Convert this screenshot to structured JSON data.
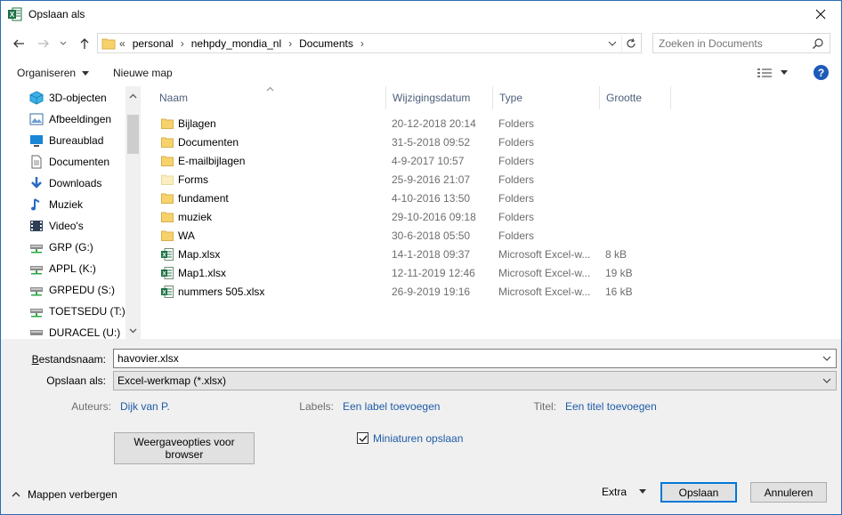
{
  "window": {
    "title": "Opslaan als",
    "close_label": "✕"
  },
  "address": {
    "overflow": "«",
    "crumbs": [
      "personal",
      "nehpdy_mondia_nl",
      "Documents"
    ]
  },
  "search": {
    "placeholder": "Zoeken in Documents"
  },
  "toolbar": {
    "organize_label": "Organiseren",
    "new_folder_label": "Nieuwe map",
    "help_label": "?"
  },
  "nav": {
    "items": [
      {
        "label": "3D-objecten",
        "icon": "3d-objects-icon"
      },
      {
        "label": "Afbeeldingen",
        "icon": "pictures-icon"
      },
      {
        "label": "Bureaublad",
        "icon": "desktop-icon"
      },
      {
        "label": "Documenten",
        "icon": "documents-icon"
      },
      {
        "label": "Downloads",
        "icon": "downloads-icon"
      },
      {
        "label": "Muziek",
        "icon": "music-icon"
      },
      {
        "label": "Video's",
        "icon": "videos-icon"
      },
      {
        "label": "GRP (G:)",
        "icon": "network-drive-icon"
      },
      {
        "label": "APPL (K:)",
        "icon": "network-drive-icon"
      },
      {
        "label": "GRPEDU (S:)",
        "icon": "network-drive-icon"
      },
      {
        "label": "TOETSEDU (T:)",
        "icon": "network-drive-icon"
      },
      {
        "label": "DURACEL (U:)",
        "icon": "usb-drive-icon"
      }
    ]
  },
  "columns": {
    "name": "Naam",
    "date": "Wijzigingsdatum",
    "type": "Type",
    "size": "Grootte"
  },
  "files": [
    {
      "name": "Bijlagen",
      "date": "20-12-2018 20:14",
      "type": "Folders",
      "size": "",
      "kind": "folder"
    },
    {
      "name": "Documenten",
      "date": "31-5-2018 09:52",
      "type": "Folders",
      "size": "",
      "kind": "folder"
    },
    {
      "name": "E-mailbijlagen",
      "date": "4-9-2017 10:57",
      "type": "Folders",
      "size": "",
      "kind": "folder"
    },
    {
      "name": "Forms",
      "date": "25-9-2016 21:07",
      "type": "Folders",
      "size": "",
      "kind": "folder-light"
    },
    {
      "name": "fundament",
      "date": "4-10-2016 13:50",
      "type": "Folders",
      "size": "",
      "kind": "folder"
    },
    {
      "name": "muziek",
      "date": "29-10-2016 09:18",
      "type": "Folders",
      "size": "",
      "kind": "folder"
    },
    {
      "name": "WA",
      "date": "30-6-2018 05:50",
      "type": "Folders",
      "size": "",
      "kind": "folder"
    },
    {
      "name": "Map.xlsx",
      "date": "14-1-2018 09:37",
      "type": "Microsoft Excel-w...",
      "size": "8 kB",
      "kind": "excel"
    },
    {
      "name": "Map1.xlsx",
      "date": "12-11-2019 12:46",
      "type": "Microsoft Excel-w...",
      "size": "19 kB",
      "kind": "excel"
    },
    {
      "name": "nummers 505.xlsx",
      "date": "26-9-2019 19:16",
      "type": "Microsoft Excel-w...",
      "size": "16 kB",
      "kind": "excel"
    }
  ],
  "form": {
    "filename_label": "Bestandsnaam:",
    "filename_value": "havovier.xlsx",
    "savetype_label": "Opslaan als:",
    "savetype_value": "Excel-werkmap (*.xlsx)",
    "authors_label": "Auteurs:",
    "authors_value": "Dijk van P.",
    "tags_label": "Labels:",
    "tags_value": "Een label toevoegen",
    "title_label": "Titel:",
    "title_value": "Een titel toevoegen",
    "web_options_label": "Weergaveopties voor browser",
    "thumbnails_label": "Miniaturen opslaan",
    "thumbnails_checked": true
  },
  "footer": {
    "hide_folders_label": "Mappen verbergen",
    "extra_label": "Extra",
    "save_label": "Opslaan",
    "cancel_label": "Annuleren"
  },
  "colors": {
    "accent": "#0078d7",
    "link": "#1f5ba8",
    "folder": "#f7d26b",
    "excel": "#1e7145"
  }
}
